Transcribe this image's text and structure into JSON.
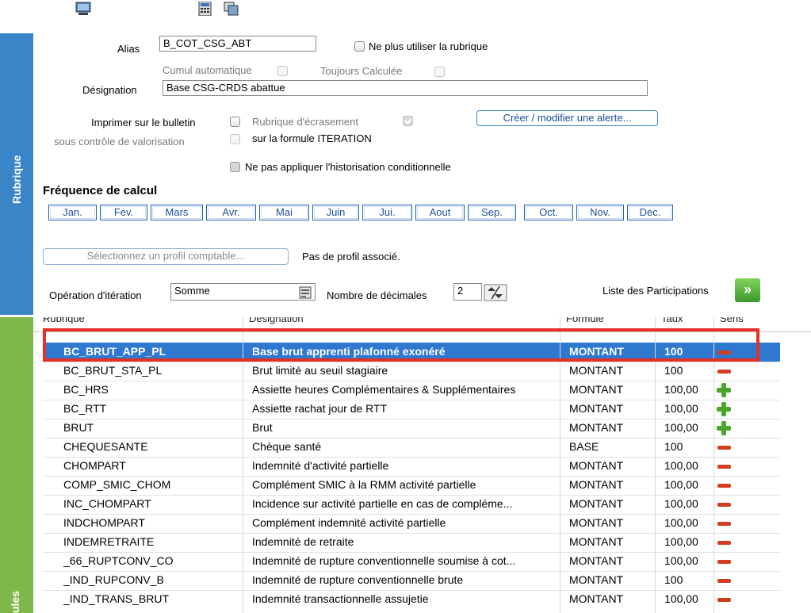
{
  "side_labels": {
    "top": "Rubrique",
    "bottom": "ules"
  },
  "form": {
    "alias_label": "Alias",
    "alias_value": "B_COT_CSG_ABT",
    "no_longer_use_label": "Ne plus utiliser la rubrique",
    "cumul_label": "Cumul automatique",
    "toujours_label": "Toujours Calculée",
    "designation_label": "Désignation",
    "designation_value": "Base CSG-CRDS abattue",
    "imprimer_label": "Imprimer sur le bulletin",
    "sous_controle_label": "sous contrôle de valorisation",
    "ecrasement_label": "Rubrique d'écrasement",
    "iteration_formula_label": "sur la formule ITERATION",
    "alert_button": "Créer / modifier une alerte...",
    "historisation_label": "Ne pas appliquer l'historisation conditionnelle"
  },
  "frequence": {
    "title": "Fréquence de calcul",
    "months": [
      "Jan.",
      "Fev.",
      "Mars",
      "Avr.",
      "Mai",
      "Juin",
      "Jui.",
      "Aout",
      "Sep.",
      "Oct.",
      "Nov.",
      "Dec."
    ]
  },
  "profil": {
    "button": "Sélectionnez un profil comptable...",
    "status": "Pas de profil associé."
  },
  "operation": {
    "label": "Opération d'itération",
    "value": "Somme",
    "decimales_label": "Nombre de décimales",
    "decimales_value": "2",
    "participations_label": "Liste des Participations"
  },
  "table": {
    "headers": {
      "rubrique": "Rubrique",
      "designation": "Désignation",
      "formule": "Formule",
      "taux": "Taux",
      "sens": "Sens"
    },
    "rows": [
      {
        "rubrique": "BC_BRUT_APP_PL",
        "designation": "Base brut apprenti plafonné exonéré",
        "formule": "MONTANT",
        "taux": "100",
        "sens": "minus"
      },
      {
        "rubrique": "BC_BRUT_STA_PL",
        "designation": "Brut limité au seuil stagiaire",
        "formule": "MONTANT",
        "taux": "100",
        "sens": "minus"
      },
      {
        "rubrique": "BC_HRS",
        "designation": "Assiette heures Complémentaires & Supplémentaires",
        "formule": "MONTANT",
        "taux": "100,00",
        "sens": "plus"
      },
      {
        "rubrique": "BC_RTT",
        "designation": "Assiette rachat jour de RTT",
        "formule": "MONTANT",
        "taux": "100,00",
        "sens": "plus"
      },
      {
        "rubrique": "BRUT",
        "designation": "Brut",
        "formule": "MONTANT",
        "taux": "100,00",
        "sens": "plus"
      },
      {
        "rubrique": "CHEQUESANTE",
        "designation": "Chèque santé",
        "formule": "BASE",
        "taux": "100",
        "sens": "minus"
      },
      {
        "rubrique": "CHOMPART",
        "designation": "Indemnité d'activité partielle",
        "formule": "MONTANT",
        "taux": "100,00",
        "sens": "minus"
      },
      {
        "rubrique": "COMP_SMIC_CHOM",
        "designation": "Complément SMIC à la RMM activité partielle",
        "formule": "MONTANT",
        "taux": "100,00",
        "sens": "minus"
      },
      {
        "rubrique": "INC_CHOMPART",
        "designation": "Incidence sur activité partielle en cas de compléme...",
        "formule": "MONTANT",
        "taux": "100,00",
        "sens": "minus"
      },
      {
        "rubrique": "INDCHOMPART",
        "designation": "Complément indemnité activité partielle",
        "formule": "MONTANT",
        "taux": "100,00",
        "sens": "minus"
      },
      {
        "rubrique": "INDEMRETRAITE",
        "designation": "Indemnité de retraite",
        "formule": "MONTANT",
        "taux": "100,00",
        "sens": "minus"
      },
      {
        "rubrique": "_66_RUPTCONV_CO",
        "designation": "Indemnité de rupture conventionnelle soumise à cot...",
        "formule": "MONTANT",
        "taux": "100,00",
        "sens": "minus"
      },
      {
        "rubrique": "_IND_RUPCONV_B",
        "designation": "Indemnité de rupture conventionnelle brute",
        "formule": "MONTANT",
        "taux": "100",
        "sens": "minus"
      },
      {
        "rubrique": "_IND_TRANS_BRUT",
        "designation": "Indemnité transactionnelle assujetie",
        "formule": "MONTANT",
        "taux": "100,00",
        "sens": "minus"
      }
    ]
  }
}
